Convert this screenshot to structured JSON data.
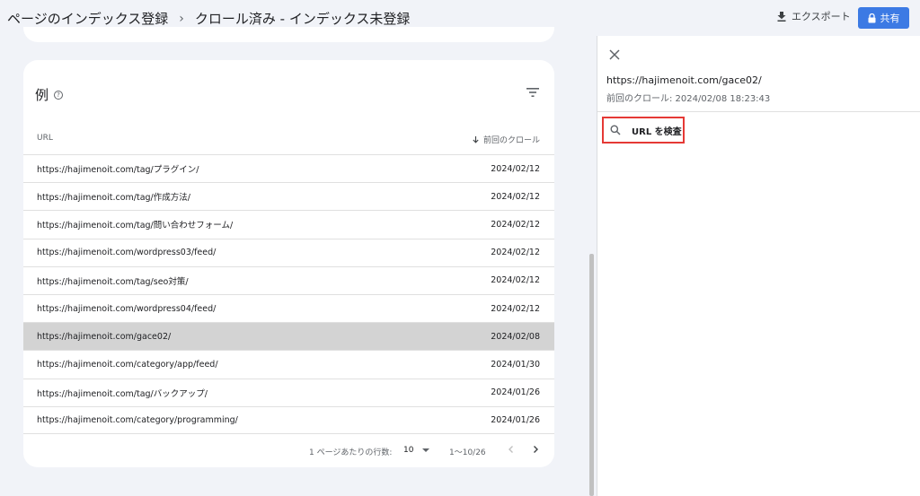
{
  "header": {
    "breadcrumb_root": "ページのインデックス登録",
    "breadcrumb_separator": "›",
    "breadcrumb_current": "クロール済み - インデックス未登録",
    "export_label": "エクスポート",
    "share_label": "共有"
  },
  "examples": {
    "title": "例",
    "col_url": "URL",
    "col_last_crawl": "前回のクロール",
    "rows": [
      {
        "url": "https://hajimenoit.com/tag/プラグイン/",
        "date": "2024/02/12"
      },
      {
        "url": "https://hajimenoit.com/tag/作成方法/",
        "date": "2024/02/12"
      },
      {
        "url": "https://hajimenoit.com/tag/問い合わせフォーム/",
        "date": "2024/02/12"
      },
      {
        "url": "https://hajimenoit.com/wordpress03/feed/",
        "date": "2024/02/12"
      },
      {
        "url": "https://hajimenoit.com/tag/seo対策/",
        "date": "2024/02/12"
      },
      {
        "url": "https://hajimenoit.com/wordpress04/feed/",
        "date": "2024/02/12"
      },
      {
        "url": "https://hajimenoit.com/gace02/",
        "date": "2024/02/08"
      },
      {
        "url": "https://hajimenoit.com/category/app/feed/",
        "date": "2024/01/30"
      },
      {
        "url": "https://hajimenoit.com/tag/バックアップ/",
        "date": "2024/01/26"
      },
      {
        "url": "https://hajimenoit.com/category/programming/",
        "date": "2024/01/26"
      }
    ],
    "selected_row": 6
  },
  "pagination": {
    "rows_per_page_label": "1 ページあたりの行数:",
    "rows_per_page_value": "10",
    "range_label": "1～10/26"
  },
  "panel": {
    "url": "https://hajimenoit.com/gace02/",
    "last_crawl": "前回のクロール: 2024/02/08 18:23:43",
    "inspect_label": "URL を検査"
  },
  "icons": {
    "export": "download-icon",
    "share": "lock-icon",
    "help": "help-icon",
    "filter": "filter-icon",
    "sort": "arrow-down-icon",
    "close": "close-icon",
    "search": "search-icon",
    "prev": "chevron-left-icon",
    "next": "chevron-right-icon"
  },
  "colors": {
    "accent": "#3c7ae4",
    "highlight_border": "#e53935",
    "selected_row": "#d3d3d3"
  }
}
